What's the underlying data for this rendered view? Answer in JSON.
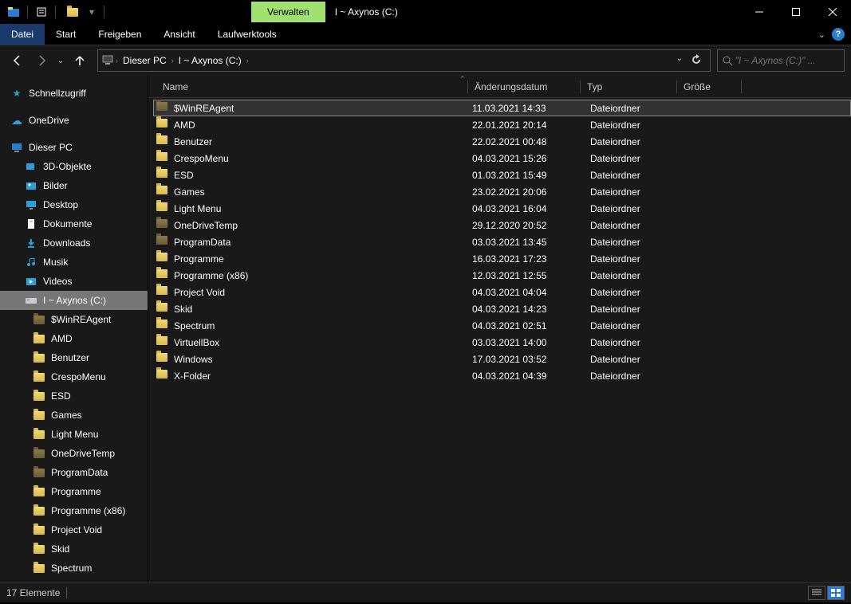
{
  "title": "I ~ Axynos (C:)",
  "verwalten": "Verwalten",
  "ribbon": {
    "file": "Datei",
    "start": "Start",
    "share": "Freigeben",
    "view": "Ansicht",
    "tools": "Laufwerktools"
  },
  "breadcrumb": {
    "pc": "Dieser PC",
    "drive": "I ~ Axynos (C:)"
  },
  "search_placeholder": "\"I ~ Axynos (C:)\" ...",
  "columns": {
    "name": "Name",
    "date": "Änderungsdatum",
    "type": "Typ",
    "size": "Größe"
  },
  "sidebar": {
    "quick": "Schnellzugriff",
    "onedrive": "OneDrive",
    "pc": "Dieser PC",
    "pc_items": [
      "3D-Objekte",
      "Bilder",
      "Desktop",
      "Dokumente",
      "Downloads",
      "Musik",
      "Videos"
    ],
    "drive": "I ~ Axynos (C:)",
    "drive_items": [
      {
        "n": "$WinREAgent",
        "d": true
      },
      {
        "n": "AMD",
        "d": false
      },
      {
        "n": "Benutzer",
        "d": false
      },
      {
        "n": "CrespoMenu",
        "d": false
      },
      {
        "n": "ESD",
        "d": false
      },
      {
        "n": "Games",
        "d": false
      },
      {
        "n": "Light Menu",
        "d": false
      },
      {
        "n": "OneDriveTemp",
        "d": true
      },
      {
        "n": "ProgramData",
        "d": true
      },
      {
        "n": "Programme",
        "d": false
      },
      {
        "n": "Programme (x86)",
        "d": false
      },
      {
        "n": "Project Void",
        "d": false
      },
      {
        "n": "Skid",
        "d": false
      },
      {
        "n": "Spectrum",
        "d": false
      }
    ]
  },
  "files": [
    {
      "name": "$WinREAgent",
      "date": "11.03.2021 14:33",
      "type": "Dateiordner",
      "dark": true,
      "sel": true
    },
    {
      "name": "AMD",
      "date": "22.01.2021 20:14",
      "type": "Dateiordner",
      "dark": false
    },
    {
      "name": "Benutzer",
      "date": "22.02.2021 00:48",
      "type": "Dateiordner",
      "dark": false
    },
    {
      "name": "CrespoMenu",
      "date": "04.03.2021 15:26",
      "type": "Dateiordner",
      "dark": false
    },
    {
      "name": "ESD",
      "date": "01.03.2021 15:49",
      "type": "Dateiordner",
      "dark": false
    },
    {
      "name": "Games",
      "date": "23.02.2021 20:06",
      "type": "Dateiordner",
      "dark": false
    },
    {
      "name": "Light Menu",
      "date": "04.03.2021 16:04",
      "type": "Dateiordner",
      "dark": false
    },
    {
      "name": "OneDriveTemp",
      "date": "29.12.2020 20:52",
      "type": "Dateiordner",
      "dark": true
    },
    {
      "name": "ProgramData",
      "date": "03.03.2021 13:45",
      "type": "Dateiordner",
      "dark": true
    },
    {
      "name": "Programme",
      "date": "16.03.2021 17:23",
      "type": "Dateiordner",
      "dark": false
    },
    {
      "name": "Programme (x86)",
      "date": "12.03.2021 12:55",
      "type": "Dateiordner",
      "dark": false
    },
    {
      "name": "Project Void",
      "date": "04.03.2021 04:04",
      "type": "Dateiordner",
      "dark": false
    },
    {
      "name": "Skid",
      "date": "04.03.2021 14:23",
      "type": "Dateiordner",
      "dark": false
    },
    {
      "name": "Spectrum",
      "date": "04.03.2021 02:51",
      "type": "Dateiordner",
      "dark": false
    },
    {
      "name": "VirtuellBox",
      "date": "03.03.2021 14:00",
      "type": "Dateiordner",
      "dark": false
    },
    {
      "name": "Windows",
      "date": "17.03.2021 03:52",
      "type": "Dateiordner",
      "dark": false
    },
    {
      "name": "X-Folder",
      "date": "04.03.2021 04:39",
      "type": "Dateiordner",
      "dark": false
    }
  ],
  "status": "17 Elemente"
}
